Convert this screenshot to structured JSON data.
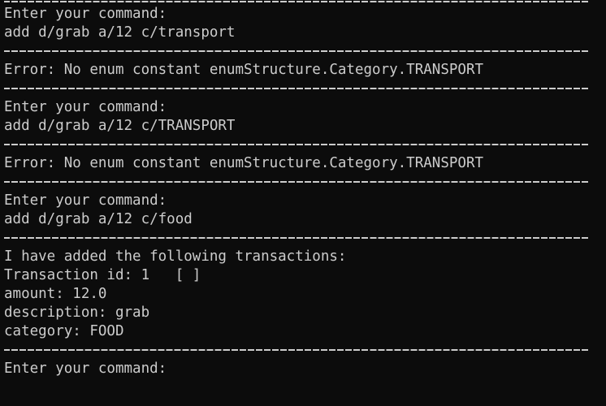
{
  "terminal": {
    "lines": [
      {
        "kind": "prompt",
        "text": "Enter your command:"
      },
      {
        "kind": "input",
        "text": "add d/grab a/12 c/transport"
      },
      {
        "kind": "separator"
      },
      {
        "kind": "error",
        "text": "Error: No enum constant enumStructure.Category.TRANSPORT"
      },
      {
        "kind": "separator"
      },
      {
        "kind": "prompt",
        "text": "Enter your command:"
      },
      {
        "kind": "input",
        "text": "add d/grab a/12 c/TRANSPORT"
      },
      {
        "kind": "separator"
      },
      {
        "kind": "error",
        "text": "Error: No enum constant enumStructure.Category.TRANSPORT"
      },
      {
        "kind": "separator"
      },
      {
        "kind": "prompt",
        "text": "Enter your command:"
      },
      {
        "kind": "input",
        "text": "add d/grab a/12 c/food"
      },
      {
        "kind": "separator"
      },
      {
        "kind": "output",
        "text": "I have added the following transactions:"
      },
      {
        "kind": "output",
        "text": "Transaction id: 1   [ ]"
      },
      {
        "kind": "output",
        "text": "amount: 12.0"
      },
      {
        "kind": "output",
        "text": "description: grab"
      },
      {
        "kind": "output",
        "text": "category: FOOD"
      },
      {
        "kind": "separator"
      },
      {
        "kind": "prompt",
        "text": "Enter your command:"
      }
    ]
  },
  "colors": {
    "background": "#0c0c0c",
    "foreground": "#cccccc"
  }
}
